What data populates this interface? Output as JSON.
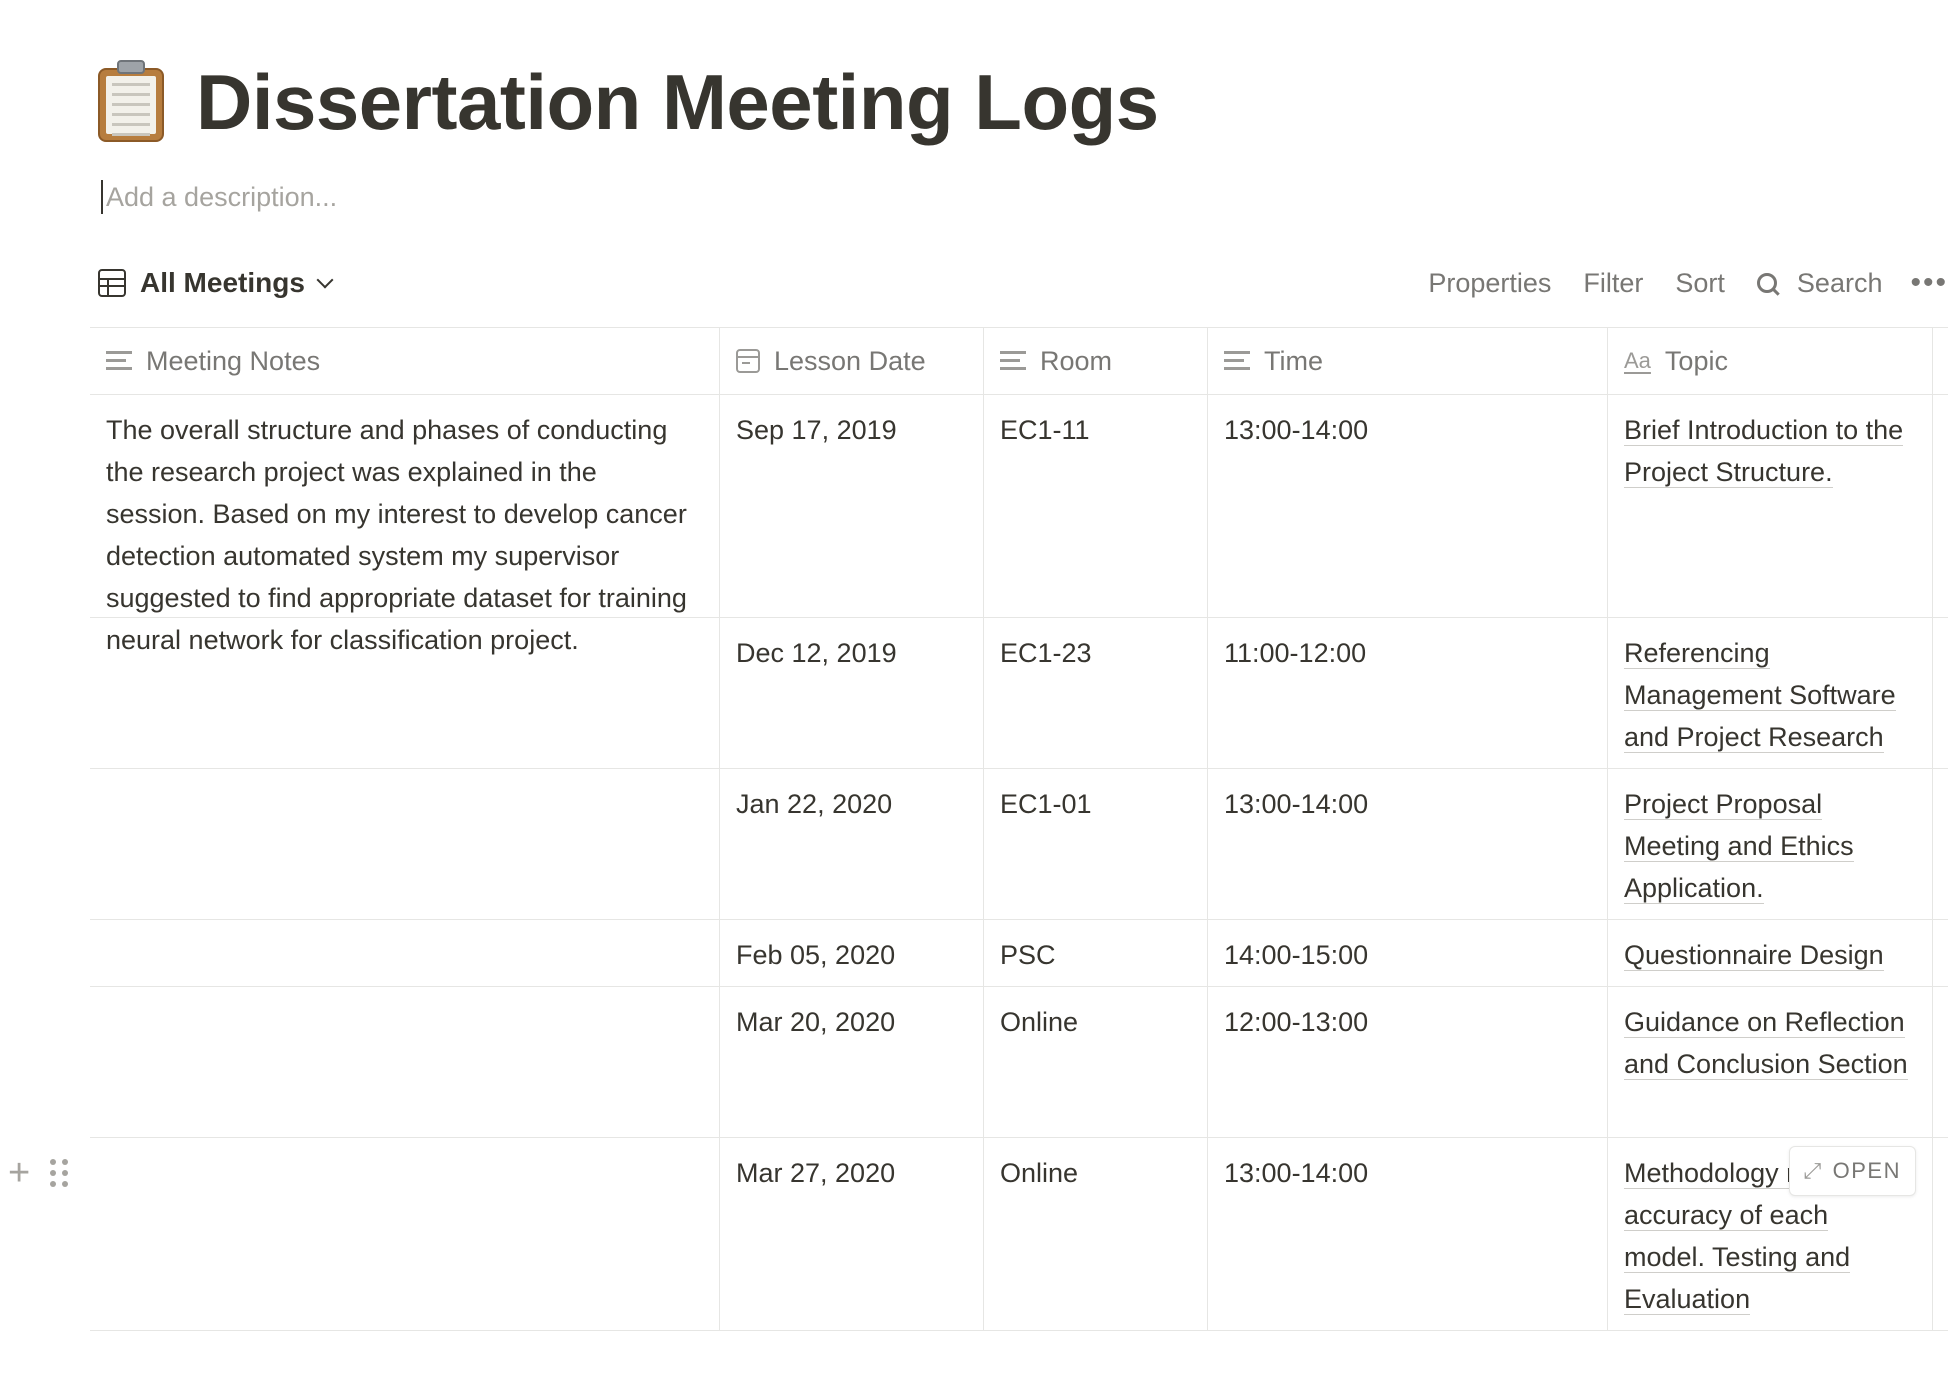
{
  "page": {
    "title": "Dissertation Meeting Logs",
    "icon": "clipboard-icon",
    "description_placeholder": "Add a description..."
  },
  "view": {
    "name": "All Meetings",
    "icon": "table-view-icon",
    "actions": {
      "properties": "Properties",
      "filter": "Filter",
      "sort": "Sort",
      "search": "Search",
      "more": "•••"
    }
  },
  "table": {
    "columns": [
      {
        "label": "Meeting Notes",
        "icon": "text-lines-icon"
      },
      {
        "label": "Lesson Date",
        "icon": "calendar-icon"
      },
      {
        "label": "Room",
        "icon": "text-lines-icon"
      },
      {
        "label": "Time",
        "icon": "text-lines-icon"
      },
      {
        "label": "Topic",
        "icon": "title-aa-icon",
        "icon_text": "Aa"
      }
    ],
    "rows": [
      {
        "notes": "The overall structure and phases of conducting the research project was explained in the session.  Based on my interest to develop cancer detection automated system my supervisor suggested to find appropriate dataset for training neural network for classification project.",
        "date": "Sep 17, 2019",
        "room": "EC1-11",
        "time": "13:00-14:00",
        "topic": "Brief Introduction to the Project Structure."
      },
      {
        "notes": "",
        "date": "Dec 12, 2019",
        "room": "EC1-23",
        "time": "11:00-12:00",
        "topic": "Referencing Management Software and Project Research"
      },
      {
        "notes": "",
        "date": "Jan 22, 2020",
        "room": "EC1-01",
        "time": "13:00-14:00",
        "topic": "Project Proposal Meeting and Ethics Application."
      },
      {
        "notes": "",
        "date": "Feb 05, 2020",
        "room": "PSC",
        "time": "14:00-15:00",
        "topic": "Questionnaire Design"
      },
      {
        "notes": "",
        "date": "Mar 20, 2020",
        "room": "Online",
        "time": "12:00-13:00",
        "topic": "Guidance on Reflection and Conclusion Section"
      },
      {
        "notes": "",
        "date": "Mar 27, 2020",
        "room": "Online",
        "time": "13:00-14:00",
        "topic": "Methodology requires accuracy of each model. Testing and Evaluation"
      }
    ],
    "row_hover": {
      "add_icon": "plus-icon",
      "drag_icon": "drag-handle-icon",
      "open_label": "OPEN",
      "open_icon": "expand-arrow-icon"
    }
  }
}
